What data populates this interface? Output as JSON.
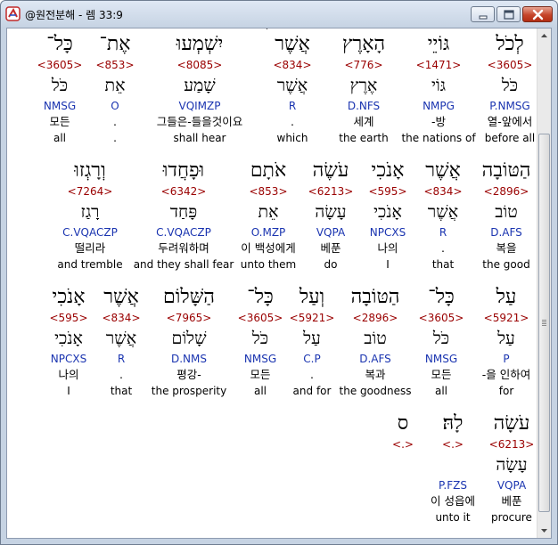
{
  "window": {
    "title": "@원전분해 - 렘 33:9"
  },
  "rows": [
    {
      "cells": [
        {
          "heb": "לְכֹל",
          "strong": "<3605>",
          "lemma": "כֹּל",
          "morph": "P.NMSG",
          "kor": "열-앞에서",
          "eng": "before all"
        },
        {
          "heb": "גּוֹיֵי",
          "strong": "<1471>",
          "lemma": "גּוֹי",
          "morph": "NMPG",
          "kor": "-방",
          "eng": "the nations of"
        },
        {
          "heb": "הָאָרֶץ",
          "strong": "<776>",
          "lemma": "אֶרֶץ",
          "morph": "D.NFS",
          "kor": "세계",
          "eng": "the earth"
        },
        {
          "heb": "אֲשֶׁר",
          "strong": "<834>",
          "lemma": "אֲשֶׁר",
          "morph": "R",
          "kor": ".",
          "eng": "which"
        },
        {
          "heb": "יִשְׁמְעוּ",
          "strong": "<8085>",
          "lemma": "שָׁמַע",
          "morph": "VQIMZP",
          "kor": "그들은-들을것이요",
          "eng": "shall hear"
        },
        {
          "heb": "אֶת־",
          "strong": "<853>",
          "lemma": "אֵת",
          "morph": "O",
          "kor": ".",
          "eng": "."
        },
        {
          "heb": "כָּל־",
          "strong": "<3605>",
          "lemma": "כֹּל",
          "morph": "NMSG",
          "kor": "모든",
          "eng": "all"
        }
      ]
    },
    {
      "cells": [
        {
          "heb": "הַטּוֹבָה",
          "strong": "<2896>",
          "lemma": "טוֹב",
          "morph": "D.AFS",
          "kor": "복을",
          "eng": "the good"
        },
        {
          "heb": "אֲשֶׁר",
          "strong": "<834>",
          "lemma": "אֲשֶׁר",
          "morph": "R",
          "kor": ".",
          "eng": "that"
        },
        {
          "heb": "אָנֹכִי",
          "strong": "<595>",
          "lemma": "אָנֹכִי",
          "morph": "NPCXS",
          "kor": "나의",
          "eng": "I"
        },
        {
          "heb": "עֹשֶׂה",
          "strong": "<6213>",
          "lemma": "עָשָׂה",
          "morph": "VQPA",
          "kor": "베푼",
          "eng": "do"
        },
        {
          "heb": "אֹתָם",
          "strong": "<853>",
          "lemma": "אֵת",
          "morph": "O.MZP",
          "kor": "이 백성에게",
          "eng": "unto them"
        },
        {
          "heb": "וּפָחֲדוּ",
          "strong": "<6342>",
          "lemma": "פָּחַד",
          "morph": "C.VQACZP",
          "kor": "두려워하며",
          "eng": "and they shall fear"
        },
        {
          "heb": "וְרָגְזוּ",
          "strong": "<7264>",
          "lemma": "רָגַז",
          "morph": "C.VQACZP",
          "kor": "떨리라",
          "eng": "and tremble"
        }
      ]
    },
    {
      "cells": [
        {
          "heb": "עַל",
          "strong": "<5921>",
          "lemma": "עַל",
          "morph": "P",
          "kor": "-을 인하여",
          "eng": "for"
        },
        {
          "heb": "כָּל־",
          "strong": "<3605>",
          "lemma": "כֹּל",
          "morph": "NMSG",
          "kor": "모든",
          "eng": "all"
        },
        {
          "heb": "הַטּוֹבָה",
          "strong": "<2896>",
          "lemma": "טוֹב",
          "morph": "D.AFS",
          "kor": "복과",
          "eng": "the goodness"
        },
        {
          "heb": "וְעַל",
          "strong": "<5921>",
          "lemma": "עַל",
          "morph": "C.P",
          "kor": ".",
          "eng": "and for"
        },
        {
          "heb": "כָּל־",
          "strong": "<3605>",
          "lemma": "כֹּל",
          "morph": "NMSG",
          "kor": "모든",
          "eng": "all"
        },
        {
          "heb": "הַשָּׁלוֹם",
          "strong": "<7965>",
          "lemma": "שָׁלוֹם",
          "morph": "D.NMS",
          "kor": "평강-",
          "eng": "the prosperity"
        },
        {
          "heb": "אֲשֶׁר",
          "strong": "<834>",
          "lemma": "אֲשֶׁר",
          "morph": "R",
          "kor": ".",
          "eng": "that"
        },
        {
          "heb": "אָנֹכִי",
          "strong": "<595>",
          "lemma": "אָנֹכִי",
          "morph": "NPCXS",
          "kor": "나의",
          "eng": "I"
        }
      ]
    },
    {
      "cells": [
        {
          "heb": "עֹשָׂה",
          "strong": "<6213>",
          "lemma": "עָשָׂה",
          "morph": "VQPA",
          "kor": "베푼",
          "eng": "procure"
        },
        {
          "heb": "לָהּ׃",
          "strong": "<.>",
          "lemma": "",
          "morph": "P.FZS",
          "kor": "이 성읍에",
          "eng": "unto it"
        },
        {
          "heb": "ס",
          "strong": "<.>",
          "lemma": "",
          "morph": "",
          "kor": "",
          "eng": ""
        }
      ]
    }
  ],
  "colors": {
    "strong_number": "#9a0000",
    "morphology": "#1a34b0",
    "text": "#000000",
    "close_button": "#c6452a"
  },
  "icons": {
    "app": "app-logo-icon",
    "minimize": "minimize-icon",
    "maximize": "maximize-icon",
    "close": "close-icon",
    "scroll_up": "scroll-up-arrow-icon",
    "scroll_down": "scroll-down-arrow-icon"
  }
}
